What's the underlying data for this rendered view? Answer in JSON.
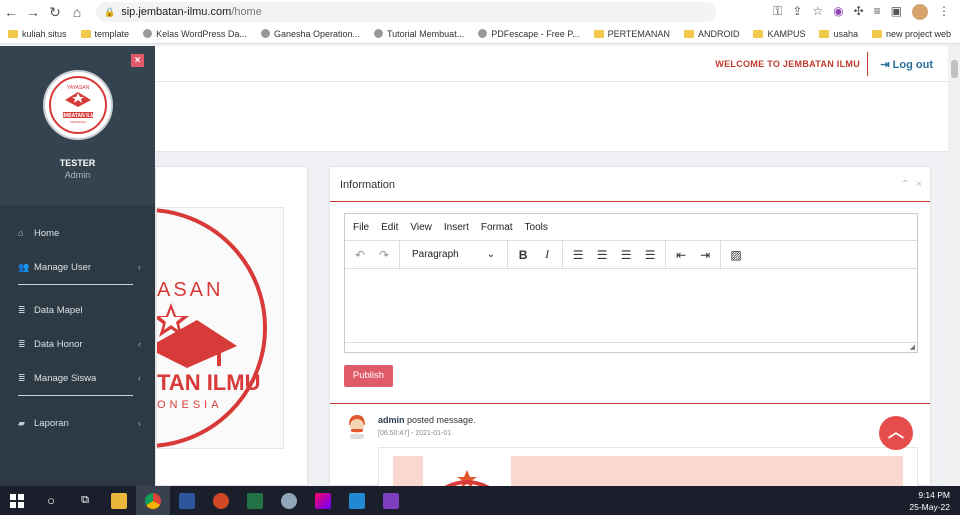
{
  "browser": {
    "url_host": "sip.jembatan-ilmu.com",
    "url_path": "/home",
    "bookmarks": [
      {
        "label": "kuliah situs",
        "icon": "folder-icon"
      },
      {
        "label": "template",
        "icon": "folder-icon"
      },
      {
        "label": "Kelas WordPress Da...",
        "icon": "site-icon"
      },
      {
        "label": "Ganesha Operation...",
        "icon": "site-icon"
      },
      {
        "label": "Tutorial Membuat...",
        "icon": "site-icon"
      },
      {
        "label": "PDFescape - Free P...",
        "icon": "site-icon"
      },
      {
        "label": "PERTEMANAN",
        "icon": "folder-icon"
      },
      {
        "label": "ANDROID",
        "icon": "folder-icon"
      },
      {
        "label": "KAMPUS",
        "icon": "folder-icon"
      },
      {
        "label": "usaha",
        "icon": "folder-icon"
      },
      {
        "label": "new project web",
        "icon": "folder-icon"
      }
    ],
    "more": "»"
  },
  "topbar": {
    "welcome": "WELCOME TO JEMBATAN ILMU",
    "logout": "Log out"
  },
  "sidebar": {
    "logo_top": "YAYASAN",
    "logo_main": "JEMBATAN ILMU",
    "logo_sub": "INDONESIA",
    "user_name": "TESTER",
    "user_role": "Admin",
    "items": [
      {
        "label": "Home",
        "icon": "home-icon",
        "submenu": false
      },
      {
        "label": "Manage User",
        "icon": "users-icon",
        "submenu": true
      },
      {
        "label": "Data Mapel",
        "icon": "database-icon",
        "submenu": false
      },
      {
        "label": "Data Honor",
        "icon": "database-icon",
        "submenu": true
      },
      {
        "label": "Manage Siswa",
        "icon": "database-icon",
        "submenu": true
      },
      {
        "label": "Laporan",
        "icon": "book-icon",
        "submenu": true
      }
    ]
  },
  "left_panel": {
    "logo_fragment_top": "ASAN",
    "logo_fragment_main": "TAN ILMU",
    "logo_fragment_sub": "ONESIA"
  },
  "info": {
    "title": "Information",
    "editor_menu": [
      "File",
      "Edit",
      "View",
      "Insert",
      "Format",
      "Tools"
    ],
    "block_format": "Paragraph",
    "publish": "Publish",
    "post": {
      "author": "admin",
      "action": "posted message.",
      "time": "[06:50:47] - 2021-01-01"
    }
  },
  "taskbar": {
    "time": "9:14 PM",
    "date": "25-May-22"
  },
  "colors": {
    "sidebar": "#2d3943",
    "accent_red": "#e05b6a",
    "link_blue": "#2c6e9b"
  }
}
